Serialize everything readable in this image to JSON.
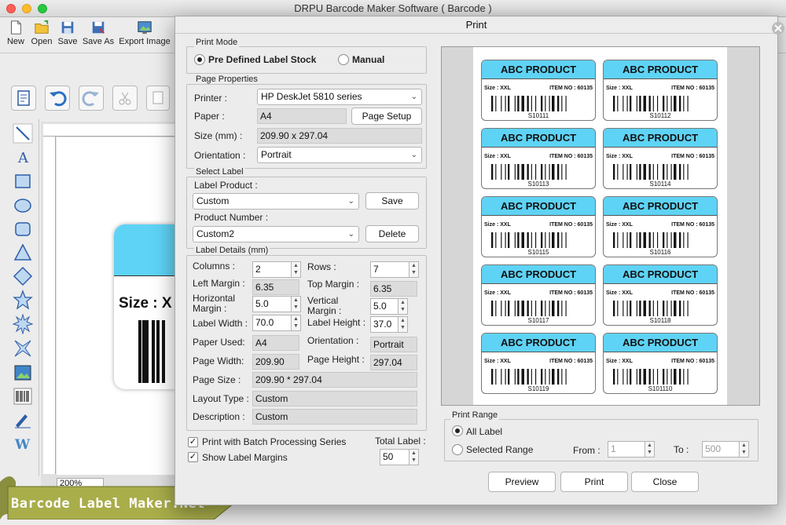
{
  "app": {
    "title": "DRPU Barcode Maker Software ( Barcode )"
  },
  "toolbar": [
    {
      "label": "New",
      "icon": "new-file-icon"
    },
    {
      "label": "Open",
      "icon": "open-folder-icon"
    },
    {
      "label": "Save",
      "icon": "save-icon"
    },
    {
      "label": "Save As",
      "icon": "save-as-icon"
    },
    {
      "label": "Export Image",
      "icon": "export-image-icon"
    }
  ],
  "canvas": {
    "zoom": "200%",
    "label_size_text": "Size : X"
  },
  "watermark": "Barcode Label Maker.Net",
  "dialog": {
    "title": "Print",
    "print_mode": {
      "title": "Print Mode",
      "option_predefined": "Pre Defined Label Stock",
      "option_manual": "Manual",
      "selected": "predefined"
    },
    "page_properties": {
      "title": "Page Properties",
      "printer_label": "Printer :",
      "printer_value": "HP DeskJet 5810 series",
      "paper_label": "Paper :",
      "paper_value": "A4",
      "page_setup": "Page Setup",
      "size_label": "Size (mm) :",
      "size_value": "209.90 x 297.04",
      "orientation_label": "Orientation :",
      "orientation_value": "Portrait"
    },
    "select_label": {
      "title": "Select Label",
      "product_label": "Label Product :",
      "product_value": "Custom",
      "save": "Save",
      "number_label": "Product Number :",
      "number_value": "Custom2",
      "delete": "Delete"
    },
    "label_details": {
      "title": "Label Details (mm)",
      "columns_label": "Columns :",
      "columns_value": "2",
      "rows_label": "Rows :",
      "rows_value": "7",
      "left_margin_label": "Left Margin :",
      "left_margin_value": "6.35",
      "top_margin_label": "Top Margin :",
      "top_margin_value": "6.35",
      "hmargin_label": "Horizontal Margin :",
      "hmargin_value": "5.0",
      "vmargin_label": "Vertical Margin :",
      "vmargin_value": "5.0",
      "label_width_label": "Label Width :",
      "label_width_value": "70.0",
      "label_height_label": "Label Height :",
      "label_height_value": "37.0",
      "paper_used_label": "Paper Used:",
      "paper_used_value": "A4",
      "orientation_label": "Orientation :",
      "orientation_value": "Portrait",
      "page_width_label": "Page Width:",
      "page_width_value": "209.90",
      "page_height_label": "Page Height :",
      "page_height_value": "297.04",
      "page_size_label": "Page Size :",
      "page_size_value": "209.90 * 297.04",
      "layout_type_label": "Layout Type :",
      "layout_type_value": "Custom",
      "description_label": "Description :",
      "description_value": "Custom"
    },
    "batch": {
      "label": "Print with Batch Processing Series",
      "checked": true
    },
    "margins": {
      "label": "Show Label Margins",
      "checked": true
    },
    "total_label": {
      "label": "Total Label :",
      "value": "50"
    },
    "preview_labels": {
      "product": "ABC PRODUCT",
      "size": "Size : XXL",
      "item_no": "ITEM NO : 60135",
      "codes": [
        "S10111",
        "S10112",
        "S10113",
        "S10114",
        "S10115",
        "S10116",
        "S10117",
        "S10118",
        "S10119",
        "S101110"
      ]
    },
    "print_range": {
      "title": "Print Range",
      "all": "All Label",
      "selected_range": "Selected Range",
      "selected": "all",
      "from_label": "From :",
      "from_value": "1",
      "to_label": "To :",
      "to_value": "500"
    },
    "buttons": {
      "preview": "Preview",
      "print": "Print",
      "close": "Close"
    }
  }
}
